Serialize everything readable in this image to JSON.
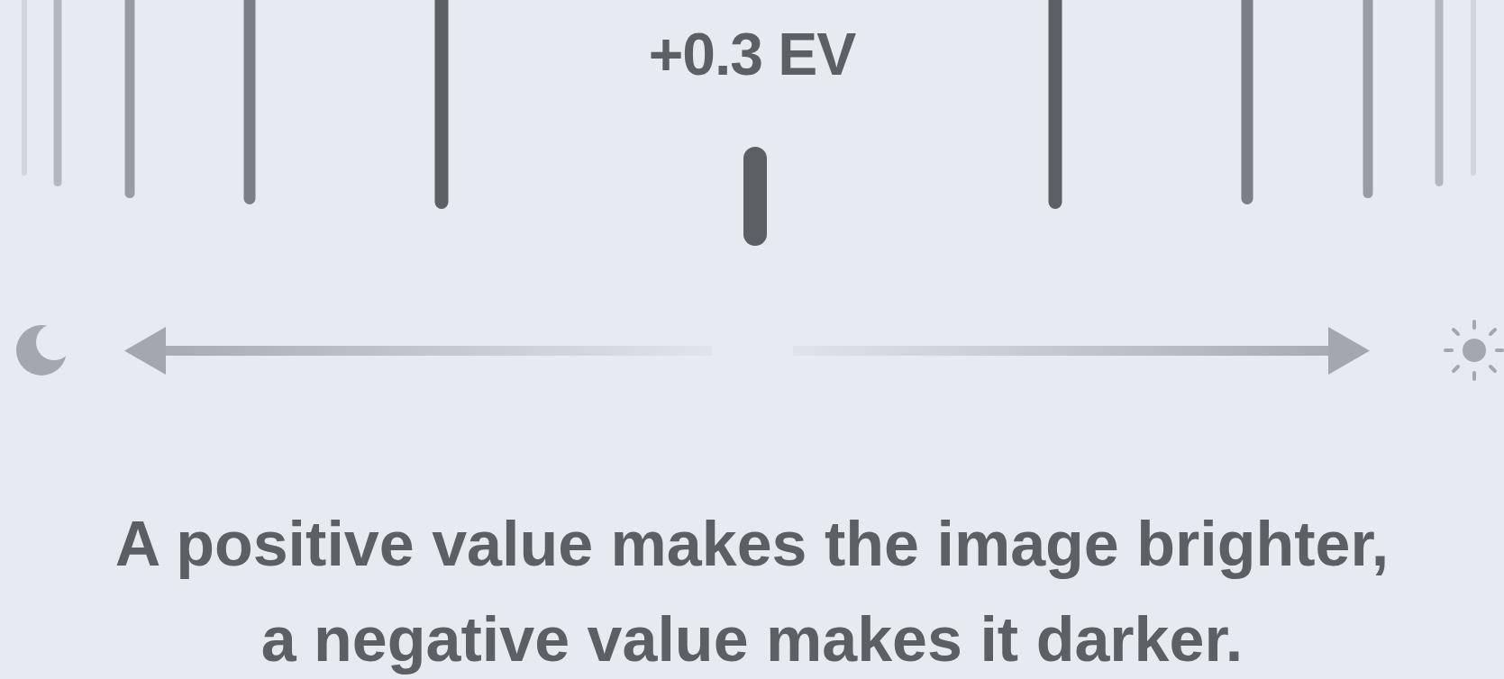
{
  "value_label": "+0.3 EV",
  "caption": [
    "A positive value makes the image brighter,",
    "a negative value makes it darker."
  ]
}
